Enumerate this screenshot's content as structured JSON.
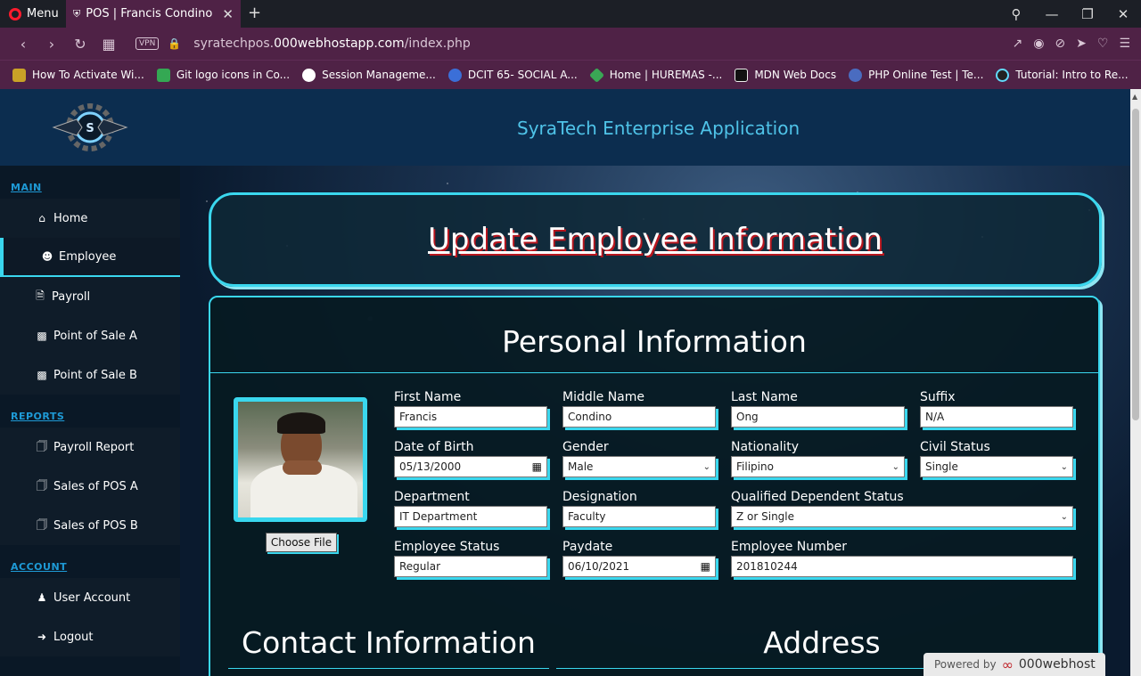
{
  "browser": {
    "menu_label": "Menu",
    "tab_title": "POS | Francis Condino Ong",
    "url_prefix": "syratechpos.",
    "url_host": "000webhostapp.com",
    "url_path": "/index.php",
    "vpn_label": "VPN",
    "bookmarks": [
      {
        "label": "How To Activate Wi...",
        "color": "#c9a227"
      },
      {
        "label": "Git logo icons in Co...",
        "color": "#34a853"
      },
      {
        "label": "Session Manageme...",
        "color": "#ffffff"
      },
      {
        "label": "DCIT 65- SOCIAL A...",
        "color": "#3b6fd8"
      },
      {
        "label": "Home | HUREMAS -...",
        "color": "#3aa655"
      },
      {
        "label": "MDN Web Docs",
        "color": "#111111"
      },
      {
        "label": "PHP Online Test | Te...",
        "color": "#4a6cc0"
      },
      {
        "label": "Tutorial: Intro to Re...",
        "color": "#61dafb"
      }
    ]
  },
  "header": {
    "app_title": "SyraTech Enterprise Application"
  },
  "sidebar": {
    "main_label": "MAIN",
    "main_items": [
      {
        "label": "Home",
        "icon": "home-icon"
      },
      {
        "label": "Employee",
        "icon": "user-circle-icon"
      },
      {
        "label": "Payroll",
        "icon": "file-icon"
      },
      {
        "label": "Point of Sale A",
        "icon": "money-icon"
      },
      {
        "label": "Point of Sale B",
        "icon": "money-icon"
      }
    ],
    "reports_label": "REPORTS",
    "report_items": [
      {
        "label": "Payroll Report",
        "icon": "files-icon"
      },
      {
        "label": "Sales of POS A",
        "icon": "files-icon"
      },
      {
        "label": "Sales of POS B",
        "icon": "files-icon"
      }
    ],
    "account_label": "ACCOUNT",
    "account_items": [
      {
        "label": "User Account",
        "icon": "users-icon"
      },
      {
        "label": "Logout",
        "icon": "logout-icon"
      }
    ]
  },
  "main": {
    "page_title": "Update Employee Information",
    "personal_title": "Personal Information",
    "choose_file_label": "Choose File",
    "fields": {
      "first_name": {
        "label": "First Name",
        "value": "Francis"
      },
      "middle_name": {
        "label": "Middle Name",
        "value": "Condino"
      },
      "last_name": {
        "label": "Last Name",
        "value": "Ong"
      },
      "suffix": {
        "label": "Suffix",
        "value": "N/A"
      },
      "dob": {
        "label": "Date of Birth",
        "value": "05/13/2000"
      },
      "gender": {
        "label": "Gender",
        "value": "Male"
      },
      "nationality": {
        "label": "Nationality",
        "value": "Filipino"
      },
      "civil_status": {
        "label": "Civil Status",
        "value": "Single"
      },
      "department": {
        "label": "Department",
        "value": "IT Department"
      },
      "designation": {
        "label": "Designation",
        "value": "Faculty"
      },
      "qualified_dependent": {
        "label": "Qualified Dependent Status",
        "value": "Z or Single"
      },
      "employee_status": {
        "label": "Employee Status",
        "value": "Regular"
      },
      "paydate": {
        "label": "Paydate",
        "value": "06/10/2021"
      },
      "employee_number": {
        "label": "Employee Number",
        "value": "201810244"
      }
    },
    "contact_title": "Contact Information",
    "address_title": "Address"
  },
  "footer": {
    "powered_label": "Powered by",
    "powered_brand": "000webhost"
  }
}
